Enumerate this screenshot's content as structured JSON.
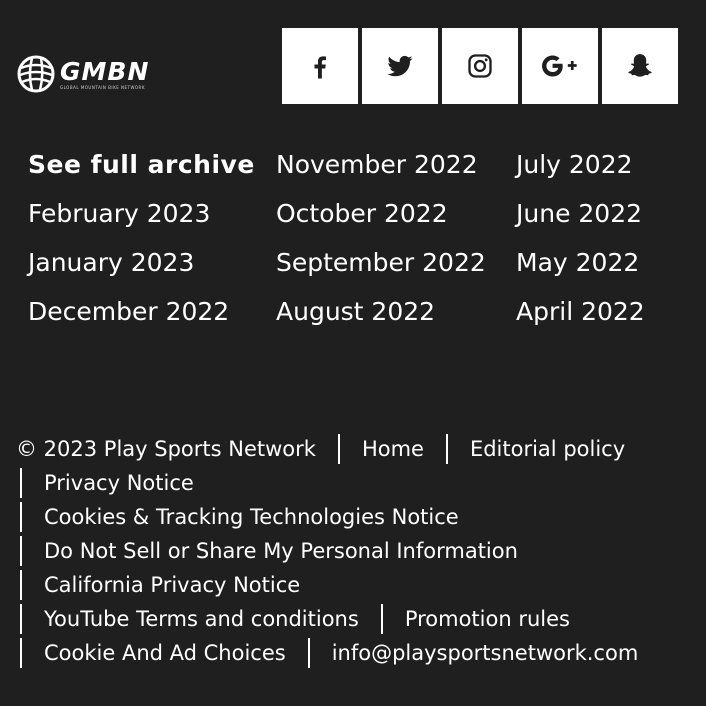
{
  "brand": {
    "name": "GMBN",
    "tagline": "GLOBAL MOUNTAIN BIKE NETWORK",
    "logo_icon": "gmbn-ball-logo"
  },
  "social": [
    {
      "name": "facebook",
      "icon": "facebook-icon"
    },
    {
      "name": "twitter",
      "icon": "twitter-icon"
    },
    {
      "name": "instagram",
      "icon": "instagram-icon"
    },
    {
      "name": "google-plus",
      "icon": "google-plus-icon",
      "label": "G+"
    },
    {
      "name": "snapchat",
      "icon": "snapchat-icon"
    }
  ],
  "archive": {
    "columns": [
      [
        "See full archive",
        "February 2023",
        "January 2023",
        "December 2022"
      ],
      [
        "November 2022",
        "October 2022",
        "September 2022",
        "August 2022"
      ],
      [
        "July 2022",
        "June 2022",
        "May 2022",
        "April 2022"
      ]
    ]
  },
  "footer": {
    "copyright": "© 2023 Play Sports Network",
    "home": "Home",
    "editorial": "Editorial policy",
    "privacy": "Privacy Notice",
    "cookies": "Cookies & Tracking Technologies Notice",
    "do_not_sell": "Do Not Sell or Share My Personal Information",
    "california": "California Privacy Notice",
    "youtube_terms": "YouTube Terms and conditions",
    "promotion": "Promotion rules",
    "ad_choices": "Cookie And Ad Choices",
    "email": "info@playsportsnetwork.com"
  },
  "colors": {
    "background": "#1f1f1f",
    "text": "#ffffff",
    "button": "#ffffff",
    "icon": "#1f1f1f"
  }
}
